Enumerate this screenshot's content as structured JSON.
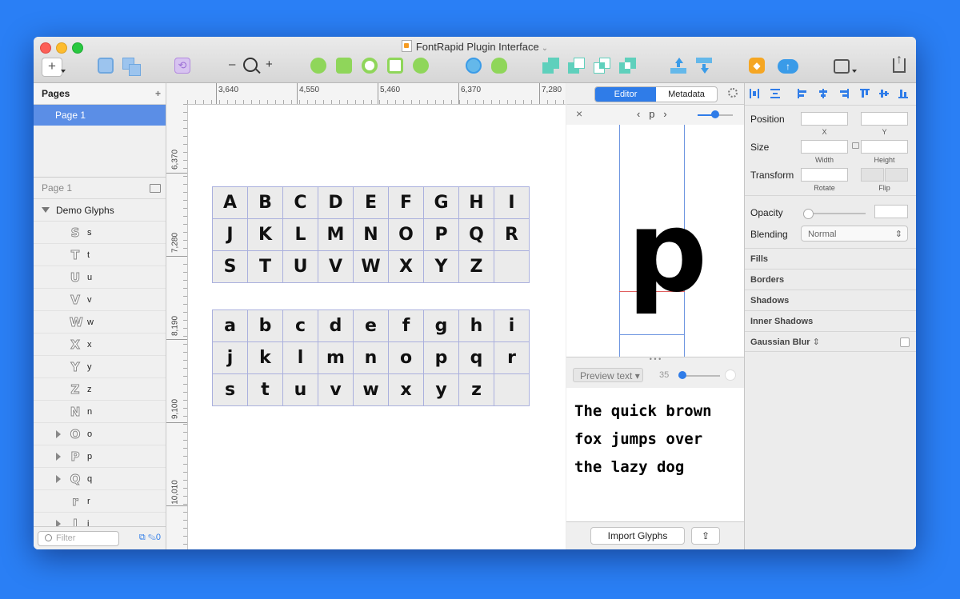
{
  "window": {
    "title": "FontRapid Plugin Interface"
  },
  "toolbar": {
    "zoom_minus": "–",
    "zoom_plus": "+",
    "colors": {
      "green": "#7ccf47",
      "teal": "#5fd0bc",
      "blue": "#3a9be8",
      "purple": "#b389e0",
      "orange": "#f59b22"
    }
  },
  "left": {
    "pages_title": "Pages",
    "pages_add": "+",
    "selected_page": "Page 1",
    "layers_page": "Page 1",
    "group_name": "Demo Glyphs",
    "layers": [
      {
        "glyph": "S",
        "name": "s",
        "expandable": false
      },
      {
        "glyph": "T",
        "name": "t",
        "expandable": false
      },
      {
        "glyph": "U",
        "name": "u",
        "expandable": false
      },
      {
        "glyph": "V",
        "name": "v",
        "expandable": false
      },
      {
        "glyph": "W",
        "name": "w",
        "expandable": false
      },
      {
        "glyph": "X",
        "name": "x",
        "expandable": false
      },
      {
        "glyph": "Y",
        "name": "y",
        "expandable": false
      },
      {
        "glyph": "Z",
        "name": "z",
        "expandable": false
      },
      {
        "glyph": "N",
        "name": "n",
        "expandable": false
      },
      {
        "glyph": "O",
        "name": "o",
        "expandable": true
      },
      {
        "glyph": "P",
        "name": "p",
        "expandable": true
      },
      {
        "glyph": "Q",
        "name": "q",
        "expandable": true
      },
      {
        "glyph": "r",
        "name": "r",
        "expandable": false
      },
      {
        "glyph": "J",
        "name": "j",
        "expandable": true
      }
    ],
    "filter_placeholder": "Filter",
    "filter_count": "0"
  },
  "canvas": {
    "h_ruler": [
      "3,640",
      "4,550",
      "5,460",
      "6,370",
      "7,280"
    ],
    "v_ruler": [
      "6,370",
      "7,280",
      "8,190",
      "9,100",
      "10,010"
    ],
    "uppercase": [
      "A",
      "B",
      "C",
      "D",
      "E",
      "F",
      "G",
      "H",
      "I",
      "J",
      "K",
      "L",
      "M",
      "N",
      "O",
      "P",
      "Q",
      "R",
      "S",
      "T",
      "U",
      "V",
      "W",
      "X",
      "Y",
      "Z",
      ""
    ],
    "lowercase": [
      "a",
      "b",
      "c",
      "d",
      "e",
      "f",
      "g",
      "h",
      "i",
      "j",
      "k",
      "l",
      "m",
      "n",
      "o",
      "p",
      "q",
      "r",
      "s",
      "t",
      "u",
      "v",
      "w",
      "x",
      "y",
      "z",
      ""
    ]
  },
  "editor": {
    "tab_editor": "Editor",
    "tab_metadata": "Metadata",
    "close": "×",
    "prev": "‹",
    "current_glyph": "p",
    "next": "›",
    "big_glyph": "p",
    "preview_label": "Preview text ▾",
    "preview_size": "35",
    "preview_text": "The quick brown\nfox jumps over\nthe lazy dog",
    "import_button": "Import Glyphs",
    "share_button": "⇪"
  },
  "inspector": {
    "position_label": "Position",
    "x_label": "X",
    "y_label": "Y",
    "size_label": "Size",
    "width_label": "Width",
    "height_label": "Height",
    "transform_label": "Transform",
    "rotate_label": "Rotate",
    "flip_label": "Flip",
    "opacity_label": "Opacity",
    "blending_label": "Blending",
    "blending_value": "Normal",
    "sections": [
      "Fills",
      "Borders",
      "Shadows",
      "Inner Shadows",
      "Gaussian Blur"
    ]
  }
}
